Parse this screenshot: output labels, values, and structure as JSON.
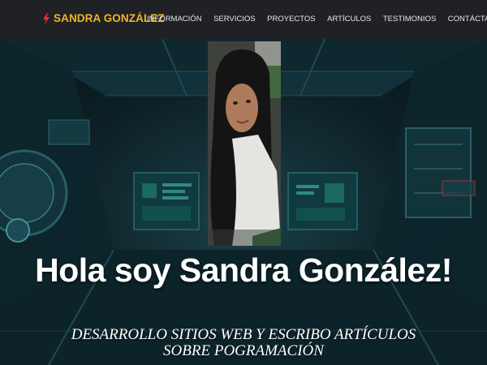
{
  "nav": {
    "brand": "SANDRA GONZÁLEZ",
    "brand_icon": "lightning-icon",
    "links": [
      "INFORMACIÓN",
      "SERVICIOS",
      "PROYECTOS",
      "ARTÍCULOS",
      "TESTIMONIOS",
      "CONTÁCTAME"
    ]
  },
  "hero": {
    "title": "Hola soy Sandra González!",
    "subtitle": "DESARROLLO SITIOS WEB Y ESCRIBO ARTÍCULOS SOBRE POGRAMACIÓN"
  },
  "colors": {
    "navbar_bg": "#1f2124",
    "brand": "#f0b429",
    "nav_text": "#e8e8e8",
    "hero_bg": "#0b1e24",
    "text": "#ffffff"
  }
}
